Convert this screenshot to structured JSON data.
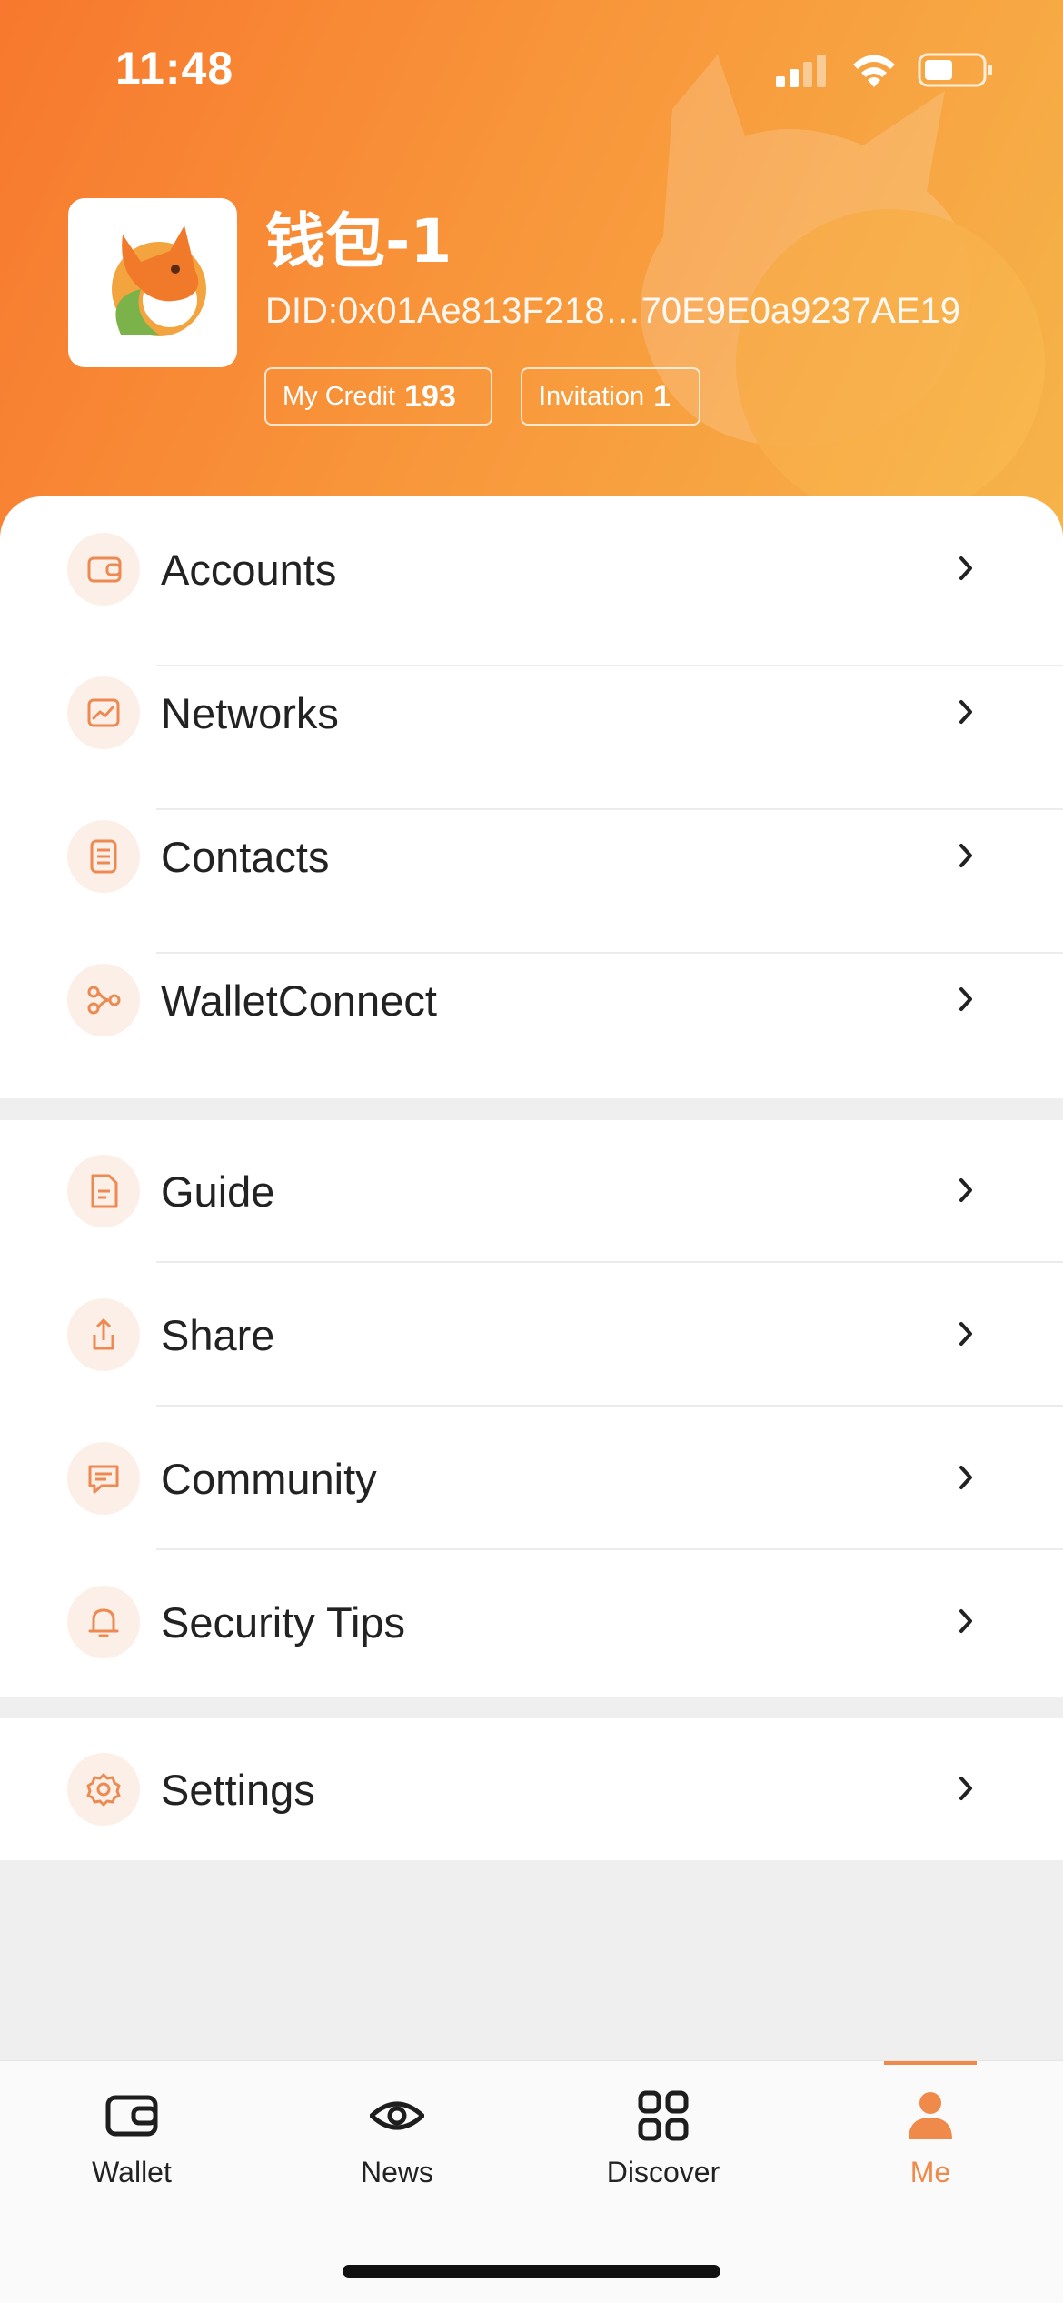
{
  "status_bar": {
    "time": "11:48",
    "icons": [
      "cellular-signal-icon",
      "wifi-icon",
      "battery-icon"
    ]
  },
  "profile": {
    "wallet_name": "钱包-1",
    "did": "DID:0x01Ae813F218…70E9E0a9237AE19",
    "avatar_icon": "fox-logo",
    "credit_label": "My Credit",
    "credit_value": "193",
    "invitation_label": "Invitation",
    "invitation_value": "1"
  },
  "menu_groups": [
    {
      "items": [
        {
          "label": "Accounts",
          "icon": "wallet-icon"
        },
        {
          "label": "Networks",
          "icon": "chart-icon"
        },
        {
          "label": "Contacts",
          "icon": "list-icon"
        },
        {
          "label": "WalletConnect",
          "icon": "connect-icon"
        }
      ]
    },
    {
      "items": [
        {
          "label": "Guide",
          "icon": "document-icon"
        },
        {
          "label": "Share",
          "icon": "share-icon"
        },
        {
          "label": "Community",
          "icon": "chat-icon"
        },
        {
          "label": "Security Tips",
          "icon": "bell-icon"
        }
      ]
    },
    {
      "items": [
        {
          "label": "Settings",
          "icon": "gear-icon"
        }
      ]
    }
  ],
  "tabbar": {
    "tabs": [
      {
        "label": "Wallet",
        "icon": "wallet-icon",
        "active": false
      },
      {
        "label": "News",
        "icon": "eye-icon",
        "active": false
      },
      {
        "label": "Discover",
        "icon": "grid-icon",
        "active": false
      },
      {
        "label": "Me",
        "icon": "person-icon",
        "active": true
      }
    ]
  },
  "colors": {
    "accent": "#f08a4b",
    "header_start": "#f7782e",
    "header_end": "#f6b44a",
    "icon_bg": "#fcefe7",
    "text": "#222222"
  }
}
